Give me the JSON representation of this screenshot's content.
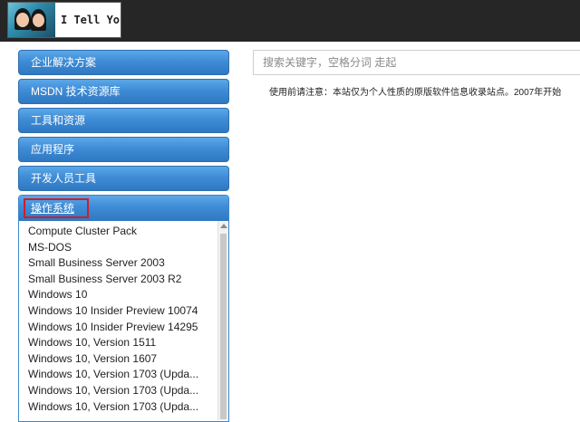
{
  "header": {
    "logo_text": "I Tell You"
  },
  "search": {
    "placeholder": "搜索关键字，空格分词 走起"
  },
  "notice": {
    "text": "使用前请注意：本站仅为个人性质的原版软件信息收录站点。2007年开始"
  },
  "sidebar": {
    "items": [
      {
        "label": "企业解决方案"
      },
      {
        "label": "MSDN 技术资源库"
      },
      {
        "label": "工具和资源"
      },
      {
        "label": "应用程序"
      },
      {
        "label": "开发人员工具"
      }
    ],
    "active_section": {
      "label": "操作系统",
      "items": [
        "Compute Cluster Pack",
        "MS-DOS",
        "Small Business Server 2003",
        "Small Business Server 2003 R2",
        "Windows 10",
        "Windows 10 Insider Preview 10074",
        "Windows 10 Insider Preview 14295",
        "Windows 10, Version 1511",
        "Windows 10, Version 1607",
        "Windows 10, Version 1703 (Upda...",
        "Windows 10, Version 1703 (Upda...",
        "Windows 10, Version 1703 (Upda..."
      ]
    }
  },
  "colors": {
    "topbar": "#262626",
    "nav_button": "#3f8cd6",
    "active_highlight": "#cc1f2d"
  }
}
